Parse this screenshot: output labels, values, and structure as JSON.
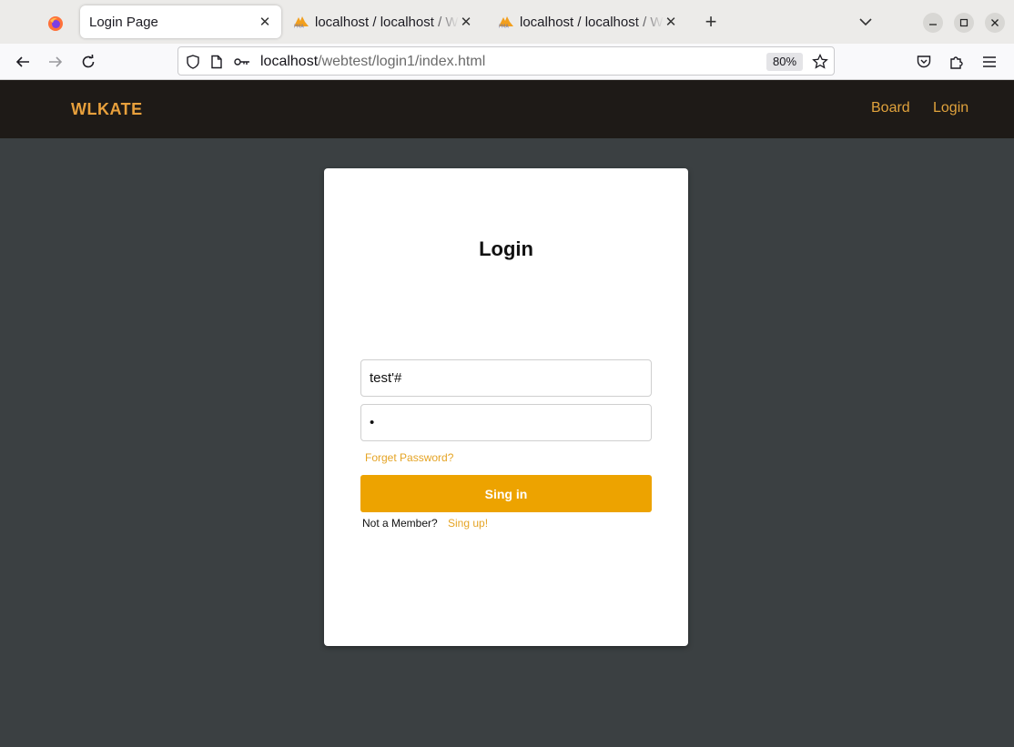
{
  "browser": {
    "tabs": [
      {
        "title": "Login Page",
        "active": true
      },
      {
        "title": "localhost / localhost / We",
        "active": false
      },
      {
        "title": "localhost / localhost / We",
        "active": false
      }
    ],
    "url": {
      "host": "localhost",
      "path": "/webtest/login1/index.html"
    },
    "zoom": "80%",
    "icons": [
      "firefox-icon",
      "phpmyadmin-icon",
      "back-icon",
      "forward-icon",
      "reload-icon",
      "shield-icon",
      "page-icon",
      "key-icon",
      "star-icon",
      "pocket-icon",
      "extensions-icon",
      "menu-icon"
    ]
  },
  "header": {
    "brand": "WLKATE",
    "nav": [
      {
        "label": "Board"
      },
      {
        "label": "Login"
      }
    ]
  },
  "login": {
    "title": "Login",
    "username_value": "test'#",
    "password_value": "•",
    "forgot": "Forget Password?",
    "submit": "Sing in",
    "member_text": "Not a Member?",
    "signup": "Sing up!"
  },
  "colors": {
    "accent": "#eda300",
    "header_bg": "#1e1a17",
    "page_bg": "#3b4042"
  }
}
